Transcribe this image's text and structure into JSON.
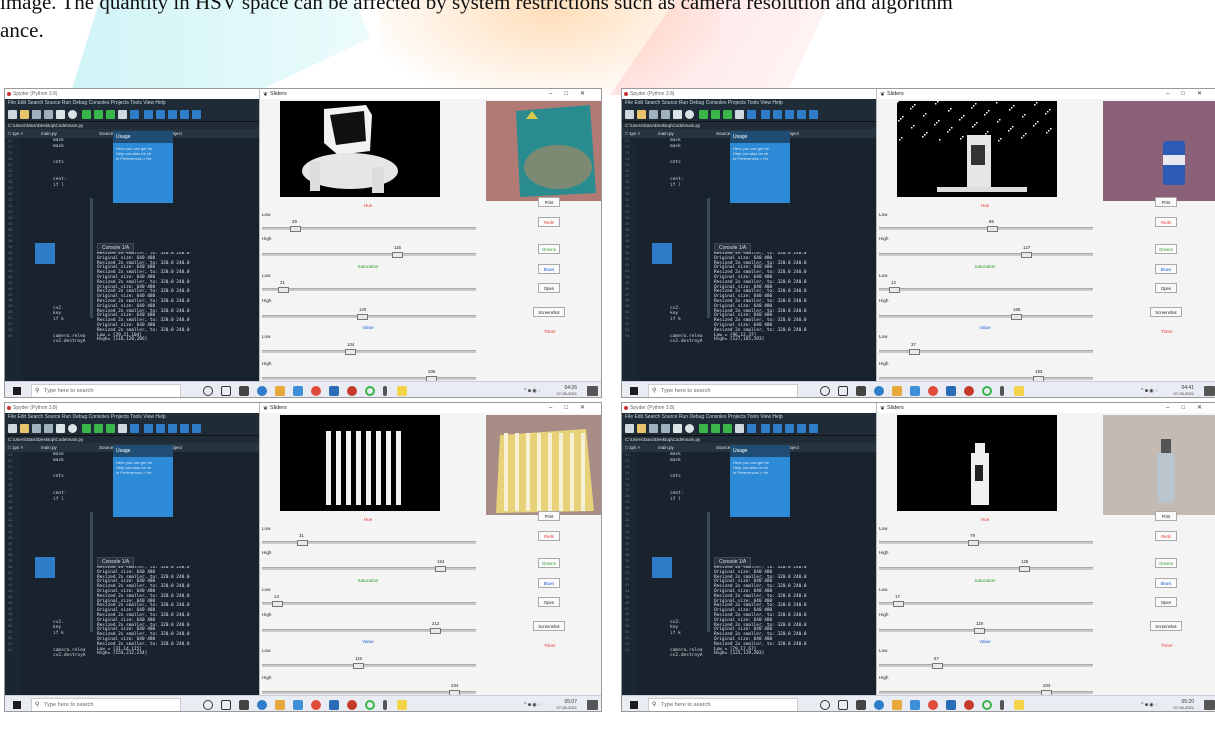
{
  "paragraph": {
    "line1": "image. The quantity in HSV space can be affected by system restrictions such as camera resolution and algorithm",
    "line2": "ance."
  },
  "spyder": {
    "title": "Spyder (Python 3.8)",
    "menu": "File  Edit  Search  Source  Run  Debug  Consoles  Projects  Tools  View  Help",
    "path": "C:\\Users\\Daru\\Desktop\\Code\\main.py",
    "tab_file": "main.py",
    "tab_source": "Source",
    "tab_console": "Console",
    "tab_object": "Object",
    "line_numbers": "21\n22\n23\n24\n25\n26\n27\n28\n29\n30\n31\n32\n33\n34\n35\n36\n37\n38\n39\n40\n41\n42\n43\n44\n45\n46\n47\n48\n49\n50\n51\n52\n53\n54",
    "code": "mask\nmask\n\n\ncnts\n\n\ncent:\nif l\n\n\n\n\n\n\n\n\n\n\n\n\n\n\n\n\n\n\n\n\n\ncv2.\nkey \nif k\n\n\ncamera.relea\ncv2.destroyA",
    "usage_title": "Usage",
    "usage_text1": "Here you can get he",
    "usage_text2": "Help can also be sh",
    "usage_text3": "in Preferences > He",
    "console_tab": "Console 1/A",
    "console_lines": "Resized 2x smaller, to: 320.0 240.0\nOriginal size: 640 480\nResized 2x smaller, to: 320.0 240.0\nOriginal size: 640 480\nResized 2x smaller, to: 320.0 240.0\nOriginal size: 640 480\nResized 2x smaller, to: 320.0 240.0\nOriginal size: 640 480\nResized 2x smaller, to: 320.0 240.0\nOriginal size: 640 480\nResized 2x smaller, to: 320.0 240.0\nOriginal size: 640 480\nResized 2x smaller, to: 320.0 240.0\nOriginal size: 640 480\nResized 2x smaller, to: 320.0 240.0\nOriginal size: 640 480\nResized 2x smaller, to: 320.0 240.0"
  },
  "sliders_title": "Sliders",
  "labels": {
    "low": "Low",
    "high": "High",
    "hue": "Hue",
    "saturation": "Saturation",
    "value": "Value"
  },
  "buttons": {
    "print": "Print",
    "reds": "Reds",
    "greens": "Greens",
    "blues": "Blues",
    "open": "Open",
    "screenshot": "Screenshot",
    "timer": "Timer"
  },
  "taskbar": {
    "search_placeholder": "Type here to search"
  },
  "panels": [
    {
      "hue_low": "29",
      "hue_high": "116",
      "sat_low": "21",
      "sat_high": "120",
      "val_low": "104",
      "val_high": "206",
      "hue_low_frac": 0.14,
      "hue_high_frac": 0.64,
      "sat_low_frac": 0.08,
      "sat_high_frac": 0.47,
      "val_low_frac": 0.41,
      "val_high_frac": 0.81,
      "console_tail": "Low = [29,21,104]\nHigh= [116,120,206]",
      "time": "04:26",
      "date": "07-05-2021",
      "scene": "elephant"
    },
    {
      "hue_low": "96",
      "hue_high": "127",
      "sat_low": "12",
      "sat_high": "165",
      "val_low": "37",
      "val_high": "193",
      "hue_low_frac": 0.53,
      "hue_high_frac": 0.7,
      "sat_low_frac": 0.05,
      "sat_high_frac": 0.65,
      "val_low_frac": 0.15,
      "val_high_frac": 0.76,
      "console_tail": "Low = [96,12,37]\nHigh= [127,165,193]",
      "time": "04:41",
      "date": "07-05-2021",
      "scene": "can"
    },
    {
      "hue_low": "31",
      "hue_high": "154",
      "sat_low": "14",
      "sat_high": "212",
      "val_low": "115",
      "val_high": "234",
      "hue_low_frac": 0.17,
      "hue_high_frac": 0.85,
      "sat_low_frac": 0.05,
      "sat_high_frac": 0.83,
      "val_low_frac": 0.45,
      "val_high_frac": 0.92,
      "console_tail": "Low = [31,14,115]\nHigh= [154,212,234]",
      "time": "05:07",
      "date": "07-05-2021",
      "scene": "towel"
    },
    {
      "hue_low": "79",
      "hue_high": "125",
      "sat_low": "17",
      "sat_high": "119",
      "val_low": "67",
      "val_high": "203",
      "hue_low_frac": 0.44,
      "hue_high_frac": 0.69,
      "sat_low_frac": 0.07,
      "sat_high_frac": 0.47,
      "val_low_frac": 0.26,
      "val_high_frac": 0.8,
      "console_tail": "Low = [79,17,67]\nHigh= [125,119,203]",
      "time": "05:20",
      "date": "07-05-2021",
      "scene": "bottle"
    }
  ],
  "colors": {
    "spyder_bg": "#19232d",
    "hue_label": "#e53935",
    "saturation_label": "#2e9d2e",
    "value_label": "#1f5fd8",
    "usage_bg": "#2c8ad6"
  }
}
